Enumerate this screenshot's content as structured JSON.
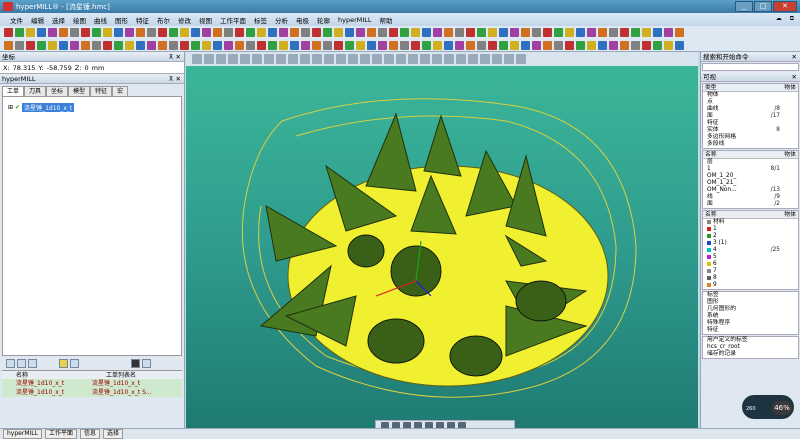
{
  "window": {
    "title": "hyperMILL® - [流星锤.hmc]"
  },
  "menu": {
    "items": [
      "文件",
      "编辑",
      "选择",
      "绘图",
      "曲线",
      "图形",
      "特征",
      "布尔",
      "修改",
      "视图",
      "工作平面",
      "标签",
      "分析",
      "电极",
      "轮廓",
      "hyperMILL",
      "帮助"
    ]
  },
  "coords": {
    "title": "坐标",
    "x_label": "X:",
    "x": "78.315",
    "y_label": "Y:",
    "y": "-58.759",
    "z_label": "Z:",
    "z": "0",
    "unit": "mm"
  },
  "hypermill_panel": {
    "title": "hyperMILL",
    "tabs": [
      "工单",
      "刀具",
      "坐标",
      "模型",
      "特征",
      "宏"
    ],
    "tree_node": "流星锤_1d10_x_t"
  },
  "job_list": {
    "col1": "名称",
    "col2": "工单列表名",
    "rows": [
      {
        "name": "流星锤_1d10_x_t",
        "list": "流星锤_1d10_x_t"
      },
      {
        "name": "流星锤_1d10_x_t",
        "list": "流星锤_1d10_x_t S..."
      }
    ]
  },
  "bottom_tabs": [
    "hyperMILL",
    "工作平面",
    "信息",
    "选择"
  ],
  "right": {
    "search_title": "搜索和开始命令",
    "visible_title": "可视",
    "type_col": "类型",
    "obj_col": "物体",
    "types": [
      {
        "n": "物体",
        "v": ""
      },
      {
        "n": "点",
        "v": ""
      },
      {
        "n": "曲线",
        "v": "/8"
      },
      {
        "n": "面",
        "v": "/17"
      },
      {
        "n": "特征",
        "v": ""
      },
      {
        "n": "实体",
        "v": "8"
      },
      {
        "n": "多边形网格",
        "v": ""
      },
      {
        "n": "多段线",
        "v": ""
      }
    ],
    "layer_hdr": "名称",
    "layer_obj": "物体",
    "layers": [
      {
        "n": "层",
        "v": ""
      },
      {
        "n": "1",
        "v": "8/1"
      },
      {
        "n": "OM_1_20_",
        "v": ""
      },
      {
        "n": "OM_1_21_",
        "v": ""
      },
      {
        "n": "OM_Non...",
        "v": "/13"
      },
      {
        "n": "线",
        "v": "/9"
      },
      {
        "n": "面",
        "v": "/2"
      }
    ],
    "mat_hdr": "名称",
    "mat_obj": "物体",
    "materials": [
      {
        "n": "材料",
        "v": "",
        "c": "#888"
      },
      {
        "n": "1",
        "v": "",
        "c": "#d02020"
      },
      {
        "n": "2",
        "v": "",
        "c": "#20a020"
      },
      {
        "n": "3 (1)",
        "v": "",
        "c": "#2040d0"
      },
      {
        "n": "4",
        "v": "/25",
        "c": "#00c0c0"
      },
      {
        "n": "5",
        "v": "",
        "c": "#c020c0"
      },
      {
        "n": "6",
        "v": "",
        "c": "#e0c000"
      },
      {
        "n": "7",
        "v": "",
        "c": "#888"
      },
      {
        "n": "8",
        "v": "",
        "c": "#606060"
      },
      {
        "n": "9",
        "v": "",
        "c": "#e08020"
      }
    ],
    "tags": [
      {
        "n": "标签"
      },
      {
        "n": "图形"
      },
      {
        "n": "几何图形的"
      },
      {
        "n": "系统"
      },
      {
        "n": "特殊程序"
      },
      {
        "n": "特征"
      }
    ],
    "udf_title": "用户定义的标签",
    "udf_item": "hcs_cr_root",
    "saved": "储存的记录"
  },
  "perf": {
    "percent": "46%",
    "rate": "260"
  }
}
